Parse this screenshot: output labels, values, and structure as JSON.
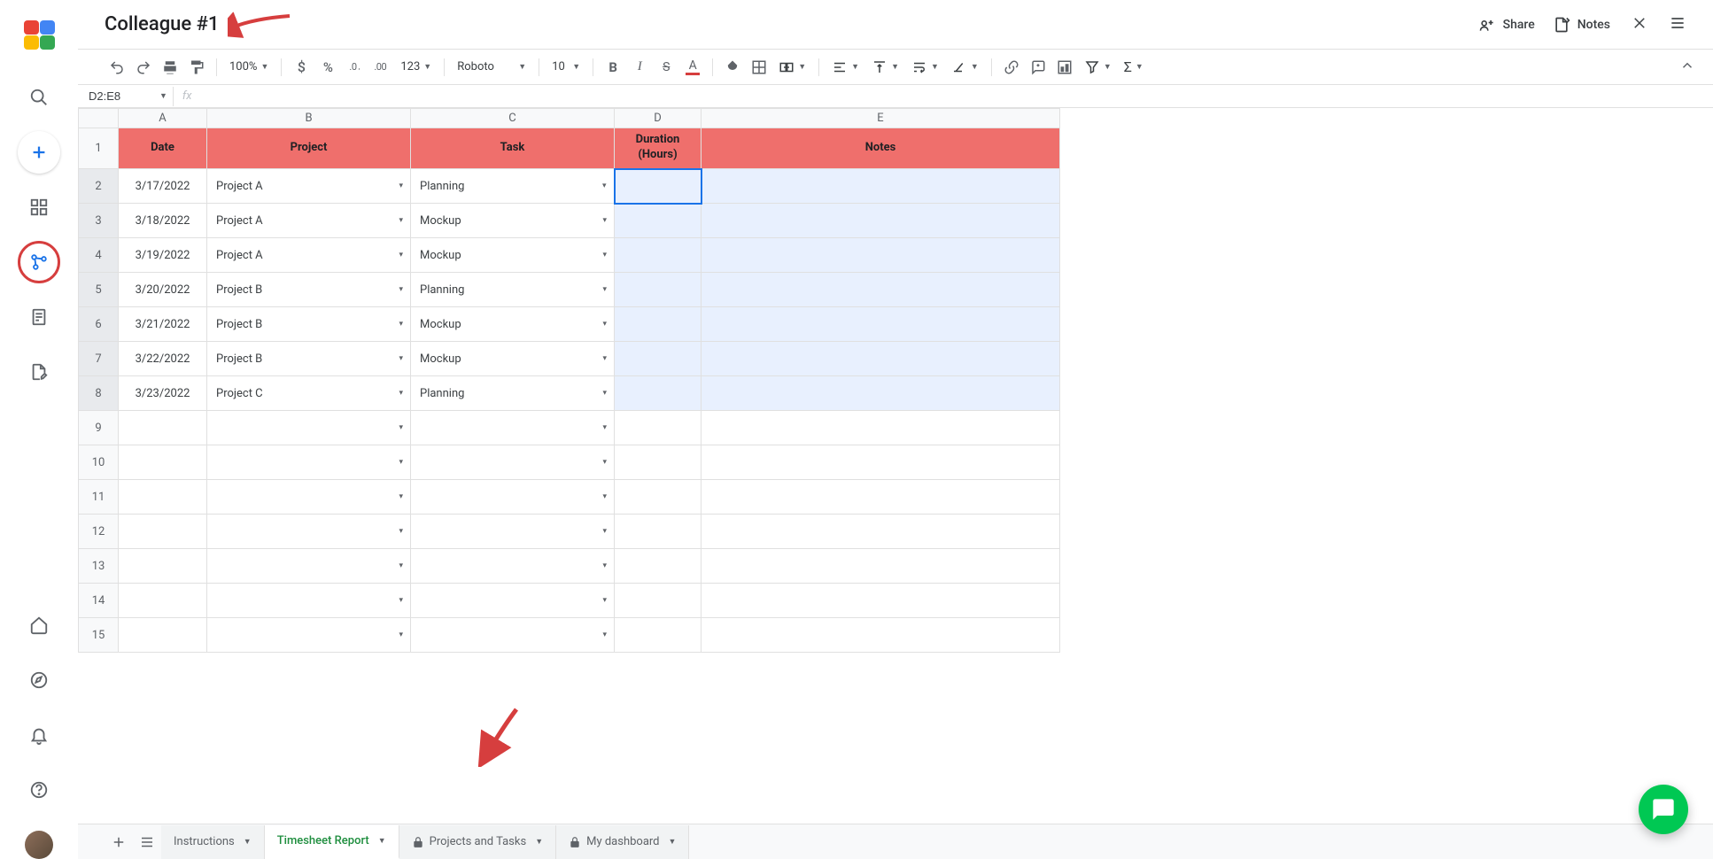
{
  "doc_title": "Colleague #1",
  "header_actions": {
    "share": "Share",
    "notes": "Notes"
  },
  "toolbar": {
    "zoom": "100%",
    "font": "Roboto",
    "font_size": "10",
    "num_format": "123"
  },
  "namebox": "D2:E8",
  "columns": [
    "A",
    "B",
    "C",
    "D",
    "E"
  ],
  "header_row": {
    "date": "Date",
    "project": "Project",
    "task": "Task",
    "duration": "Duration\n(Hours)",
    "notes": "Notes"
  },
  "rows": [
    {
      "n": 2,
      "date": "3/17/2022",
      "project": "Project A",
      "task": "Planning"
    },
    {
      "n": 3,
      "date": "3/18/2022",
      "project": "Project A",
      "task": "Mockup"
    },
    {
      "n": 4,
      "date": "3/19/2022",
      "project": "Project A",
      "task": "Mockup"
    },
    {
      "n": 5,
      "date": "3/20/2022",
      "project": "Project B",
      "task": "Planning"
    },
    {
      "n": 6,
      "date": "3/21/2022",
      "project": "Project B",
      "task": "Mockup"
    },
    {
      "n": 7,
      "date": "3/22/2022",
      "project": "Project B",
      "task": "Mockup"
    },
    {
      "n": 8,
      "date": "3/23/2022",
      "project": "Project C",
      "task": "Planning"
    }
  ],
  "empty_rows": [
    9,
    10,
    11,
    12,
    13,
    14,
    15
  ],
  "sheet_tabs": {
    "instructions": "Instructions",
    "timesheet": "Timesheet Report",
    "projects": "Projects and Tasks",
    "dashboard": "My dashboard"
  }
}
